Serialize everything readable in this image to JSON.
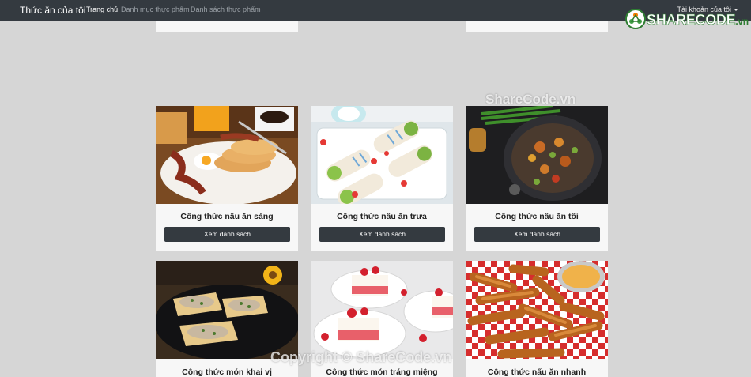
{
  "navbar": {
    "brand": "Thức ăn của tôi",
    "links": [
      "Trang chủ",
      "Danh mục thực phẩm",
      "Danh sách thực phẩm"
    ],
    "account": "Tài khoản của tôi"
  },
  "logo": {
    "share": "SHARE",
    "code": "CODE",
    "domain": ".vn"
  },
  "watermarks": {
    "center": "ShareCode.vn",
    "copyright": "Copyright © ShareCode.vn"
  },
  "cards": [
    {
      "title": "Công thức nấu ăn sáng",
      "button": "Xem danh sách",
      "image": "breakfast-plate"
    },
    {
      "title": "Công thức nấu ăn trưa",
      "button": "Xem danh sách",
      "image": "wraps-platter"
    },
    {
      "title": "Công thức nấu ăn tối",
      "button": "Xem danh sách",
      "image": "stir-fry-pan"
    },
    {
      "title": "Công thức món khai vị",
      "image": "appetizer-toasts"
    },
    {
      "title": "Công thức món tráng miệng",
      "image": "strawberry-cake"
    },
    {
      "title": "Công thức nấu ăn nhanh",
      "image": "chicken-fries"
    }
  ]
}
